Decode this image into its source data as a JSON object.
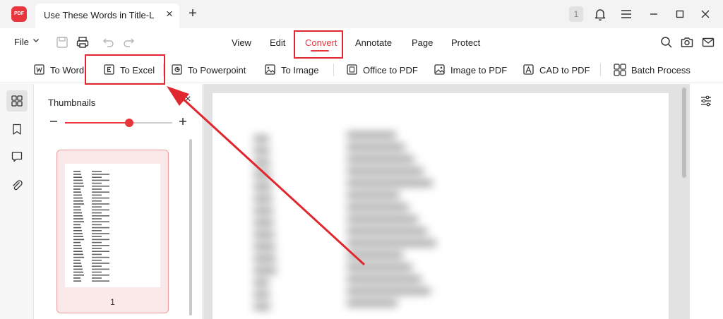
{
  "titlebar": {
    "app_logo_text": "PDF",
    "tab_title": "Use These Words in Title-L",
    "tab_close": "×",
    "new_tab": "+",
    "page_badge": "1"
  },
  "menubar": {
    "file_label": "File",
    "menus": [
      "View",
      "Edit",
      "Convert",
      "Annotate",
      "Page",
      "Protect"
    ],
    "active_menu": "Convert"
  },
  "ribbon": {
    "items": [
      "To Word",
      "To Excel",
      "To Powerpoint",
      "To Image",
      "Office to PDF",
      "Image to PDF",
      "CAD to PDF",
      "Batch Process"
    ]
  },
  "thumbnails": {
    "title": "Thumbnails",
    "close": "×",
    "zoom_level": 0.6,
    "page_number": "1"
  },
  "colors": {
    "accent": "#e8363d",
    "annotation": "#e0262e",
    "thumb_selected_bg": "#fbe8e8"
  },
  "icons": [
    "app-logo-icon",
    "chevron-down-icon",
    "save-icon",
    "print-icon",
    "undo-icon",
    "redo-icon",
    "search-icon",
    "camera-icon",
    "mail-icon",
    "bell-icon",
    "hamburger-icon",
    "minimize-icon",
    "maximize-icon",
    "close-icon",
    "thumbnails-icon",
    "bookmark-icon",
    "comment-icon",
    "attachment-icon",
    "properties-icon"
  ]
}
